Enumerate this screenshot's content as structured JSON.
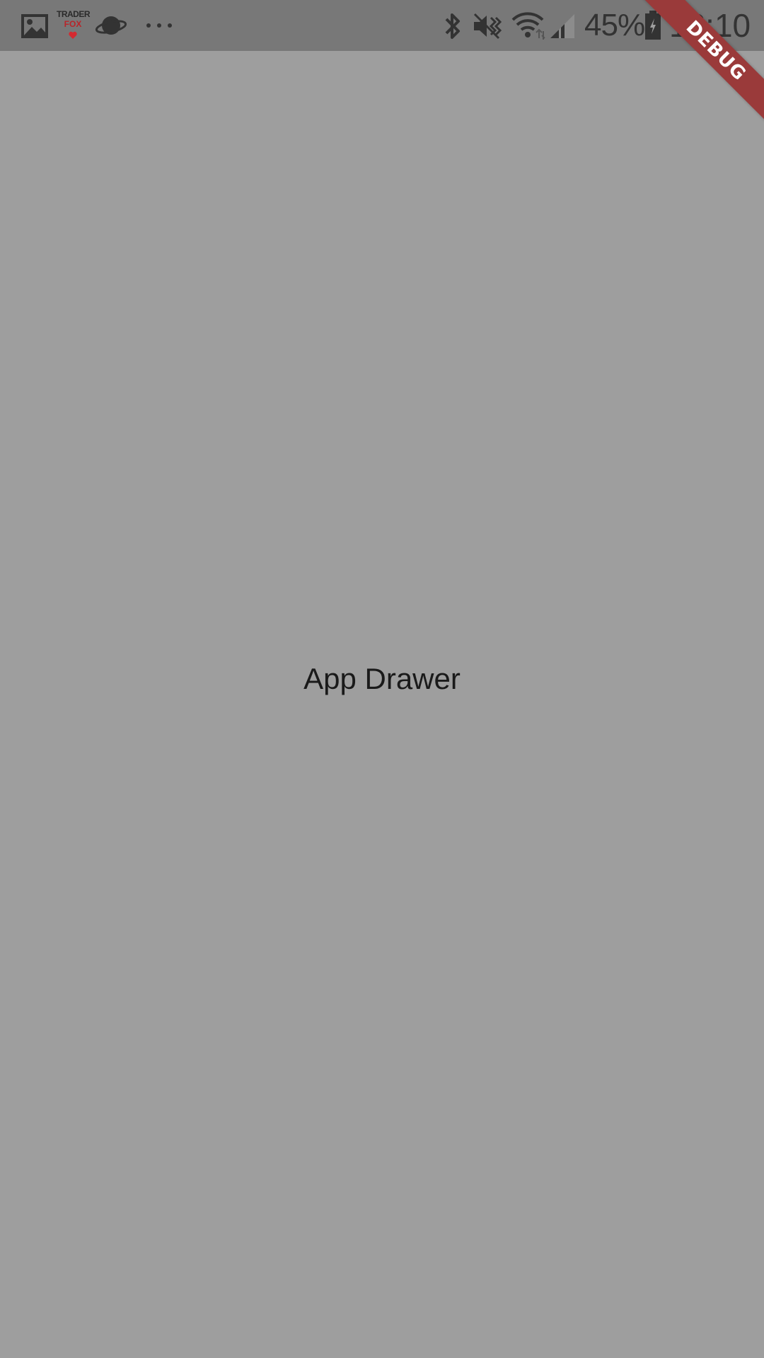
{
  "status_bar": {
    "notification_icons": [
      "image-icon",
      "trader-fox-icon",
      "planet-icon",
      "more-notifications-icon"
    ],
    "trader_logo": {
      "line1": "TRADER",
      "line2": "FOX"
    },
    "system_icons": [
      "bluetooth-icon",
      "vibrate-icon",
      "wifi-icon",
      "signal-icon",
      "battery-icon"
    ],
    "battery_percent": "45%",
    "time": "18:10",
    "background_color": "#787878",
    "icon_color": "#333333"
  },
  "main": {
    "label": "App Drawer",
    "background_color": "#9e9e9e"
  },
  "debug_banner": {
    "label": "DEBUG",
    "color": "#9a3a3a"
  }
}
